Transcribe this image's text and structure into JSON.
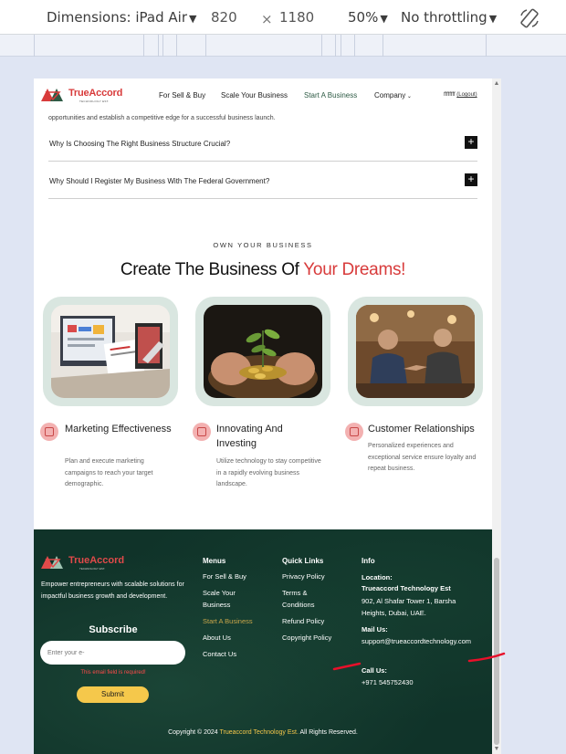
{
  "devtools": {
    "dimensions_label": "Dimensions: iPad Air",
    "width": "820",
    "times": "×",
    "height": "1180",
    "zoom": "50%",
    "throttling": "No throttling"
  },
  "nav": {
    "brand": "TrueAccord",
    "tagline": "TECHNOLOGY EST.",
    "links": [
      "For Sell & Buy",
      "Scale Your Business",
      "Start A Business",
      "Company"
    ],
    "user_name": "ffffffff",
    "logout": "(Logout)"
  },
  "faq": {
    "partial_text": "opportunities and establish a competitive edge for a successful business launch.",
    "items": [
      "Why Is Choosing The Right Business Structure Crucial?",
      "Why Should I Register My Business With The Federal Government?"
    ],
    "toggle_symbol": "+"
  },
  "hero": {
    "eyebrow": "OWN YOUR BUSINESS",
    "title_main": "Create The Business Of ",
    "title_accent": "Your Dreams!"
  },
  "features": [
    {
      "title": "Marketing Effectiveness",
      "desc": "Plan and execute marketing campaigns to reach your target demographic."
    },
    {
      "title": "Innovating And Investing",
      "desc": "Utilize technology to stay competitive in a rapidly evolving business landscape."
    },
    {
      "title": "Customer Relationships",
      "desc": "Personalized experiences and exceptional service ensure loyalty and repeat business."
    }
  ],
  "footer": {
    "brand": "TrueAccord",
    "tagline": "TECHNOLOGY EST.",
    "blurb": "Empower entrepreneurs with scalable solutions for impactful business growth and development.",
    "subscribe_title": "Subscribe",
    "email_placeholder": "Enter your e-",
    "error": "This email field is required!",
    "submit": "Submit",
    "menus_title": "Menus",
    "menus": [
      "For Sell & Buy",
      "Scale Your Business",
      "Start A Business",
      "About Us",
      "Contact Us"
    ],
    "quick_title": "Quick Links",
    "quick": [
      "Privacy Policy",
      "Terms & Conditions",
      "Refund Policy",
      "Copyright Policy"
    ],
    "info_title": "Info",
    "location_label": "Location:",
    "company": "Trueaccord Technology Est",
    "address": "902, Al Shafar Tower 1, Barsha Heights, Dubai, UAE.",
    "mail_label": "Mail Us:",
    "email": "support@trueaccordtechnology.com",
    "call_label": "Call Us:",
    "phone": "+971  545752430",
    "copyright_pre": "Copyright © 2024 ",
    "copyright_company": "Trueaccord Technology Est.",
    "copyright_post": " All Rights Reserved."
  },
  "colors": {
    "brand_red": "#d83b3b",
    "footer_green": "#103329",
    "accent_yellow": "#f5c84b"
  }
}
